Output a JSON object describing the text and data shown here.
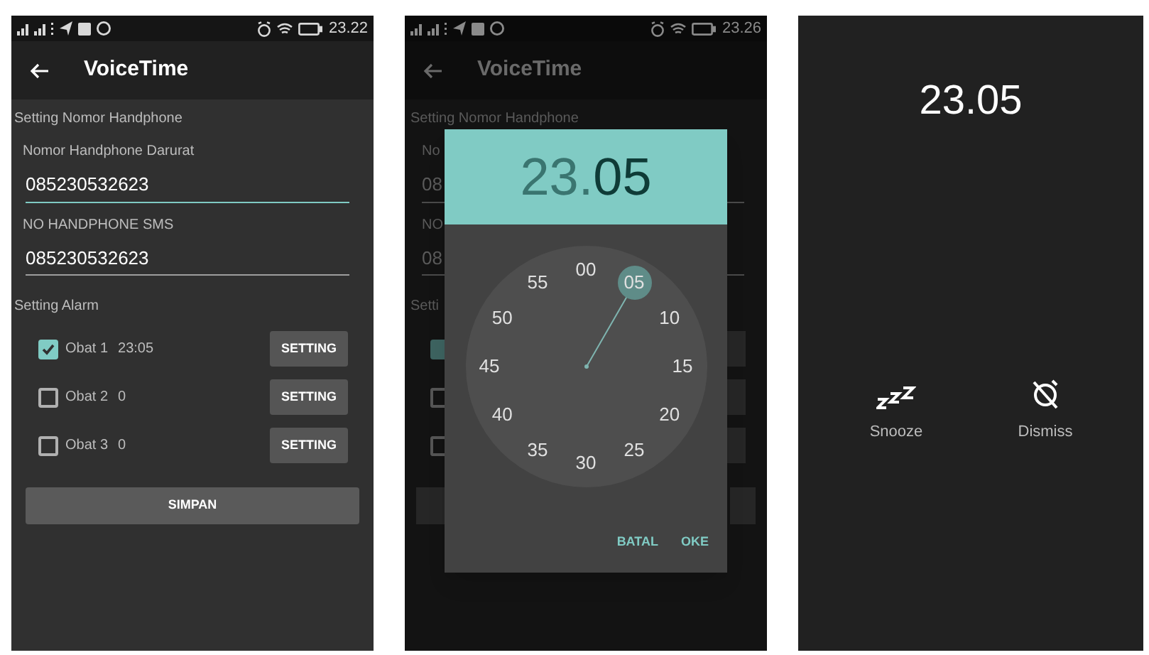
{
  "screens": [
    {
      "kind": "form",
      "status_bar": {
        "time": "23.22"
      },
      "app_bar": {
        "title": "VoiceTime"
      },
      "phone_section": {
        "title": "Setting Nomor Handphone",
        "fields": [
          {
            "label": "Nomor Handphone Darurat",
            "value": "085230532623",
            "focused": true
          },
          {
            "label": "NO HANDPHONE SMS",
            "value": "085230532623",
            "focused": false
          }
        ]
      },
      "alarm_section": {
        "title": "Setting Alarm",
        "alarms": [
          {
            "name": "Obat 1",
            "time": "23:05",
            "checked": true,
            "button": "SETTING"
          },
          {
            "name": "Obat 2",
            "time": "0",
            "checked": false,
            "button": "SETTING"
          },
          {
            "name": "Obat 3",
            "time": "0",
            "checked": false,
            "button": "SETTING"
          }
        ]
      },
      "save_button": "SIMPAN"
    },
    {
      "kind": "time_picker",
      "status_bar": {
        "time": "23.26"
      },
      "app_bar": {
        "title": "VoiceTime"
      },
      "background": {
        "section_title": "Setting Nomor Handphone",
        "fragments": [
          "No",
          "08",
          "NO",
          "08"
        ],
        "alarm_fragment": "Setti",
        "checkboxes": [
          {
            "checked": true
          },
          {
            "checked": false
          },
          {
            "checked": false
          }
        ]
      },
      "dialog": {
        "hours": {
          "text": "23",
          "selected": false
        },
        "separator": ".",
        "minutes": {
          "text": "05",
          "selected": true
        },
        "dial": [
          {
            "label": "00",
            "selected": false
          },
          {
            "label": "05",
            "selected": true
          },
          {
            "label": "10",
            "selected": false
          },
          {
            "label": "15",
            "selected": false
          },
          {
            "label": "20",
            "selected": false
          },
          {
            "label": "25",
            "selected": false
          },
          {
            "label": "30",
            "selected": false
          },
          {
            "label": "35",
            "selected": false
          },
          {
            "label": "40",
            "selected": false
          },
          {
            "label": "45",
            "selected": false
          },
          {
            "label": "50",
            "selected": false
          },
          {
            "label": "55",
            "selected": false
          }
        ],
        "buttons": [
          "BATAL",
          "OKE"
        ]
      }
    },
    {
      "kind": "alarm_ringing",
      "time": "23.05",
      "actions": [
        {
          "kind": "snooze",
          "label": "Snooze"
        },
        {
          "kind": "dismiss",
          "label": "Dismiss"
        }
      ]
    }
  ]
}
